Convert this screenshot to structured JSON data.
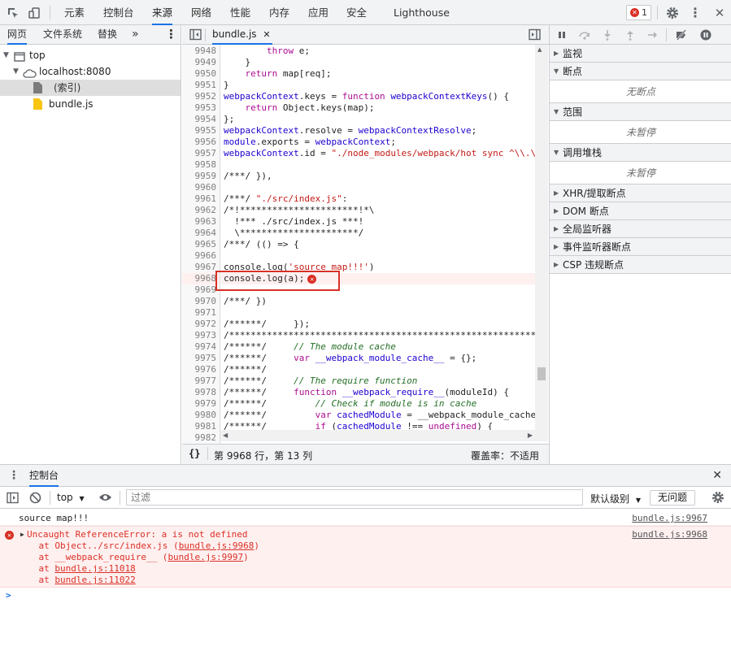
{
  "top_tabs": [
    "元素",
    "控制台",
    "来源",
    "网络",
    "性能",
    "内存",
    "应用",
    "安全",
    "Lighthouse"
  ],
  "active_tab": "来源",
  "error_count": "1",
  "navigator": {
    "tabs": [
      "网页",
      "文件系统",
      "替换"
    ],
    "more": "»",
    "tree": [
      "top",
      "localhost:8080",
      "(索引)",
      "bundle.js"
    ]
  },
  "editor": {
    "tab_label": "bundle.js",
    "status_position": "第 9968 行，第 13 列",
    "coverage": "覆盖率：不适用",
    "braces": "{}",
    "error_line": "9968",
    "lines": [
      {
        "n": "9948",
        "t": "        throw e;"
      },
      {
        "n": "9949",
        "t": "    }"
      },
      {
        "n": "9950",
        "t": "    return map[req];"
      },
      {
        "n": "9951",
        "t": "}"
      },
      {
        "n": "9952",
        "t": "webpackContext.keys = function webpackContextKeys() {"
      },
      {
        "n": "9953",
        "t": "    return Object.keys(map);"
      },
      {
        "n": "9954",
        "t": "};"
      },
      {
        "n": "9955",
        "t": "webpackContext.resolve = webpackContextResolve;"
      },
      {
        "n": "9956",
        "t": "module.exports = webpackContext;"
      },
      {
        "n": "9957",
        "t": "webpackContext.id = \"./node_modules/webpack/hot sync ^\\\\.\\"
      },
      {
        "n": "9958",
        "t": ""
      },
      {
        "n": "9959",
        "t": "/***/ }),"
      },
      {
        "n": "9960",
        "t": ""
      },
      {
        "n": "9961",
        "t": "/***/ \"./src/index.js\":"
      },
      {
        "n": "9962",
        "t": "/*!**********************!*\\"
      },
      {
        "n": "9963",
        "t": "  !*** ./src/index.js ***!"
      },
      {
        "n": "9964",
        "t": "  \\**********************/"
      },
      {
        "n": "9965",
        "t": "/***/ (() => {"
      },
      {
        "n": "9966",
        "t": ""
      },
      {
        "n": "9967",
        "t": "console.log('source map!!!')"
      },
      {
        "n": "9968",
        "t": "console.log(a);"
      },
      {
        "n": "9969",
        "t": ""
      },
      {
        "n": "9970",
        "t": "/***/ })"
      },
      {
        "n": "9971",
        "t": ""
      },
      {
        "n": "9972",
        "t": "/******/ \t});"
      },
      {
        "n": "9973",
        "t": "/************************************************************"
      },
      {
        "n": "9974",
        "t": "/******/ \t// The module cache"
      },
      {
        "n": "9975",
        "t": "/******/ \tvar __webpack_module_cache__ = {};"
      },
      {
        "n": "9976",
        "t": "/******/ \t"
      },
      {
        "n": "9977",
        "t": "/******/ \t// The require function"
      },
      {
        "n": "9978",
        "t": "/******/ \tfunction __webpack_require__(moduleId) {"
      },
      {
        "n": "9979",
        "t": "/******/ \t\t// Check if module is in cache"
      },
      {
        "n": "9980",
        "t": "/******/ \t\tvar cachedModule = __webpack_module_cache_"
      },
      {
        "n": "9981",
        "t": "/******/ \t\tif (cachedModule !== undefined) {"
      },
      {
        "n": "9982",
        "t": ""
      }
    ]
  },
  "debugger": {
    "sections": [
      {
        "title": "监视",
        "expanded": false
      },
      {
        "title": "断点",
        "expanded": true,
        "body": "无断点"
      },
      {
        "title": "范围",
        "expanded": true,
        "body": "未暂停"
      },
      {
        "title": "调用堆栈",
        "expanded": true,
        "body": "未暂停"
      },
      {
        "title": "XHR/提取断点",
        "expanded": false
      },
      {
        "title": "DOM 断点",
        "expanded": false
      },
      {
        "title": "全局监听器",
        "expanded": false
      },
      {
        "title": "事件监听器断点",
        "expanded": false
      },
      {
        "title": "CSP 违规断点",
        "expanded": false
      }
    ]
  },
  "drawer": {
    "tab": "控制台",
    "context": "top",
    "filter_placeholder": "过滤",
    "level": "默认级别",
    "issues": "无问题"
  },
  "console": {
    "log": {
      "text": "source map!!!",
      "source": "bundle.js:9967"
    },
    "error": {
      "message": "Uncaught ReferenceError: a is not defined",
      "source": "bundle.js:9968",
      "stack": [
        {
          "prefix": "    at Object../src/index.js (",
          "link": "bundle.js:9968",
          "suffix": ")"
        },
        {
          "prefix": "    at __webpack_require__ (",
          "link": "bundle.js:9997",
          "suffix": ")"
        },
        {
          "prefix": "    at ",
          "link": "bundle.js:11018",
          "suffix": ""
        },
        {
          "prefix": "    at ",
          "link": "bundle.js:11022",
          "suffix": ""
        }
      ]
    },
    "prompt": ">"
  }
}
